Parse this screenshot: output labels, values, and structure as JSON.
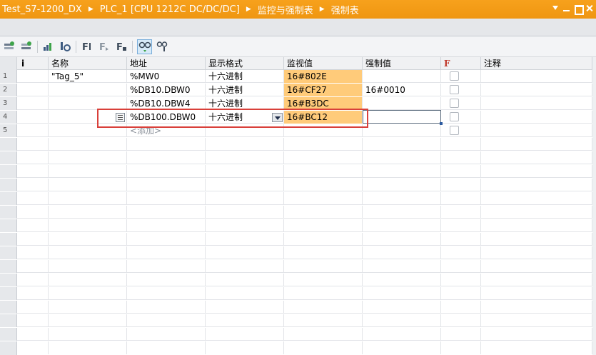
{
  "breadcrumb": [
    "Test_S7-1200_DX",
    "PLC_1 [CPU 1212C DC/DC/DC]",
    "监控与强制表",
    "强制表"
  ],
  "window_buttons": [
    "menu-icon",
    "minimize-icon",
    "maximize-icon",
    "close-icon"
  ],
  "toolbar_icons": [
    "insert-row-icon",
    "append-row-icon",
    "refresh-values-icon",
    "update-once-icon",
    "force-icon",
    "stop-force-icon",
    "force-all-icon",
    "monitor-all-glasses-icon",
    "monitor-once-glasses-icon"
  ],
  "columns": {
    "info": "i",
    "name": "名称",
    "address": "地址",
    "format": "显示格式",
    "monitor": "监视值",
    "force": "强制值",
    "f": "F",
    "comment": "注释"
  },
  "rows": [
    {
      "num": "1",
      "name": "\"Tag_5\"",
      "address": "%MW0",
      "format": "十六进制",
      "monitor": "16#802E",
      "force": ""
    },
    {
      "num": "2",
      "name": "",
      "address": "%DB10.DBW0",
      "format": "十六进制",
      "monitor": "16#CF27",
      "force": "16#0010"
    },
    {
      "num": "3",
      "name": "",
      "address": "%DB10.DBW4",
      "format": "十六进制",
      "monitor": "16#B3DC",
      "force": ""
    },
    {
      "num": "4",
      "name": "",
      "address": "%DB100.DBW0",
      "format": "十六进制",
      "monitor": "16#BC12",
      "force": ""
    },
    {
      "num": "5",
      "name": "",
      "address": "<添加>",
      "format": "",
      "monitor": "",
      "force": ""
    }
  ],
  "colors": {
    "title_bar": "#f39c12",
    "monitor_highlight": "#ffcb7a",
    "highlight_box": "#d9403a"
  }
}
